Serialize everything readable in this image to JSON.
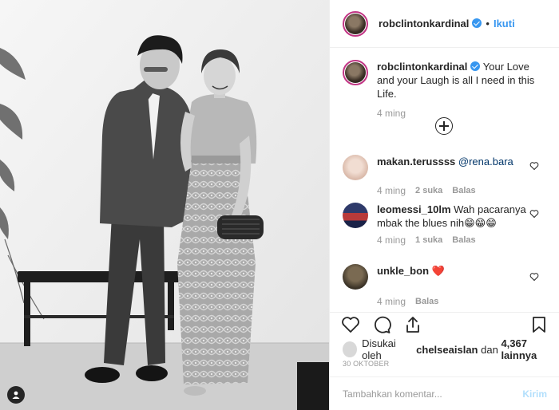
{
  "post": {
    "username": "robclintonkardinal",
    "separator": "•",
    "follow_label": "Ikuti",
    "caption_text": "Your Love and your Laugh is all I need in this Life.",
    "caption_time": "4 ming"
  },
  "comments": [
    {
      "username": "makan.terussss",
      "text_prefix": "",
      "mention": "@rena.bara",
      "emoji": "",
      "time": "4 ming",
      "likes": "2 suka",
      "reply": "Balas"
    },
    {
      "username": "leomessi_10lm",
      "text_prefix": "Wah pacaranya mbak the blues nih",
      "mention": "",
      "emoji": "😁😁😁",
      "time": "4 ming",
      "likes": "1 suka",
      "reply": "Balas"
    },
    {
      "username": "unkle_bon",
      "text_prefix": "",
      "mention": "",
      "emoji": "❤️",
      "time": "4 ming",
      "likes": "",
      "reply": "Balas"
    }
  ],
  "likes": {
    "prefix": "Disukai oleh",
    "user": "chelseaislan",
    "middle": "dan",
    "count": "4,367 lainnya"
  },
  "date": "30 OKTOBER",
  "add_comment": {
    "placeholder": "Tambahkan komentar...",
    "post_label": "Kirim"
  },
  "icons": {
    "verified": "verified-badge-icon",
    "like": "heart-icon",
    "comment": "comment-icon",
    "share": "share-icon",
    "save": "bookmark-icon",
    "load_more": "plus-circle-icon",
    "tagged": "user-tag-icon"
  },
  "colors": {
    "accent": "#3897f0",
    "text": "#262626",
    "muted": "#999999",
    "border": "#efefef",
    "heart": "#ed4956"
  }
}
